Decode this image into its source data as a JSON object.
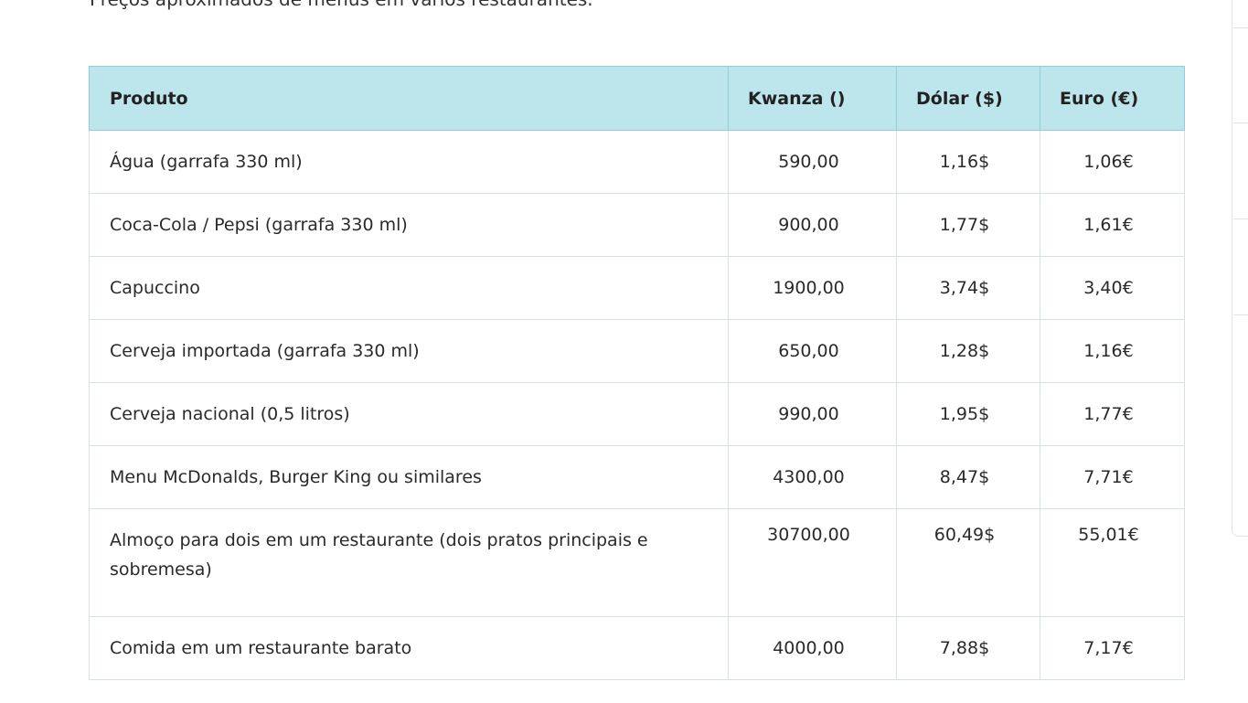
{
  "intro_text": "Preços aproximados de menus em vários restaurantes.",
  "table": {
    "headers": [
      "Produto",
      "Kwanza ()",
      "Dólar ($)",
      "Euro (€)"
    ],
    "rows": [
      {
        "produto": "Água (garrafa 330 ml)",
        "kwanza": "590,00",
        "dolar": "1,16$",
        "euro": "1,06€"
      },
      {
        "produto": "Coca-Cola / Pepsi (garrafa 330 ml)",
        "kwanza": "900,00",
        "dolar": "1,77$",
        "euro": "1,61€"
      },
      {
        "produto": "Capuccino",
        "kwanza": "1900,00",
        "dolar": "3,74$",
        "euro": "3,40€"
      },
      {
        "produto": "Cerveja importada (garrafa 330 ml)",
        "kwanza": "650,00",
        "dolar": "1,28$",
        "euro": "1,16€"
      },
      {
        "produto": "Cerveja nacional (0,5 litros)",
        "kwanza": "990,00",
        "dolar": "1,95$",
        "euro": "1,77€"
      },
      {
        "produto": "Menu McDonalds, Burger King ou similares",
        "kwanza": "4300,00",
        "dolar": "8,47$",
        "euro": "7,71€"
      },
      {
        "produto": "Almoço para dois em um restaurante (dois pratos principais e sobremesa)",
        "kwanza": "30700,00",
        "dolar": "60,49$",
        "euro": "55,01€"
      },
      {
        "produto": "Comida em um restaurante barato",
        "kwanza": "4000,00",
        "dolar": "7,88$",
        "euro": "7,17€"
      }
    ]
  },
  "colors": {
    "header_bg": "#bde5ec",
    "header_border": "#8fcfdb",
    "cell_border": "#d7e1e4"
  }
}
